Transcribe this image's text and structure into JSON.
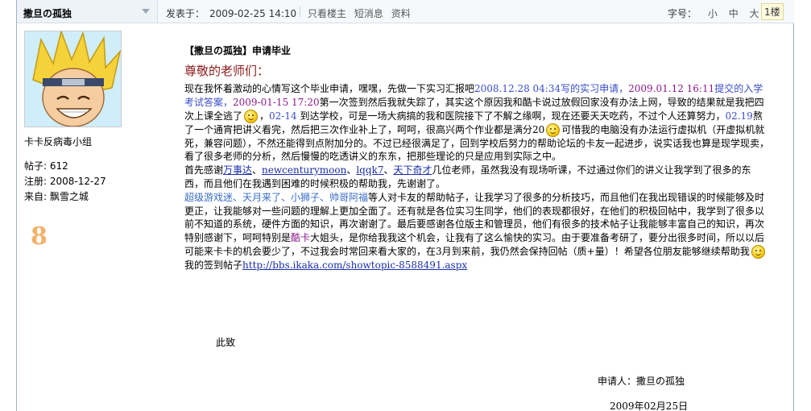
{
  "header": {
    "username": "撒旦の孤独",
    "posted_label": "发表于：",
    "posted_time": "2009-02-25 14:10",
    "links": [
      "只看楼主",
      "短消息",
      "资料"
    ],
    "font_size_label": "字号：",
    "font_sizes": [
      "小",
      "中",
      "大"
    ],
    "floor": "1楼"
  },
  "sidebar": {
    "group": "卡卡反病毒小组",
    "posts": "帖子: 612",
    "registered": "注册:  2008-12-27",
    "from": "来自: 飘雪之城",
    "rank_badge": "8"
  },
  "post": {
    "title": "【撒旦の孤独】申请毕业",
    "greeting": "尊敬的老师们：",
    "p1_a": "现在我怀着激动的心情写这个毕业申请，嘿嘿，先做一下实习汇报吧",
    "p1_b": "2008.12.28 04:34",
    "p1_c": "写的实习申请，",
    "p1_d": "2009.01.12 16:11",
    "p1_e": "提交的入学考试答案，",
    "p1_f": "2009-01-15 17:20",
    "p1_g": "第一次签到然后我就失踪了，其实这个原因我和酷卡说过放假回家没有办法上网，导致的结果就是我把四次上课全逃了",
    "p1_h": "，",
    "p1_i": "02-14",
    "p1_j": " 到达学校，可是一场大病搞的我和医院接下了不解之缘啊，现在还要天天吃药，不过个人还算努力，",
    "p1_k": "02.19",
    "p1_l": "熬了一个通宵把讲义看完，然后把三次作业补上了，呵呵，很高兴两个作业都是满分20",
    "p1_m": "可惜我的电脑没有办法运行虚拟机（开虚拟机就死，兼容问题），不然还能得到点附加分的。不过已经很满足了，回到学校后努力的帮助论坛的卡友一起进步，说实话我也算是现学现卖，看了很多老师的分析，然后慢慢的吃透讲义的东东，把那些理论的只是应用到实际之中。",
    "p2_a": "首先感谢",
    "teachers": [
      "万事达",
      "newcenturymoon",
      "lqqk7",
      "天下奇才"
    ],
    "teacher_sep": "、",
    "p2_b": "几位老师，虽然我没有现场听课，不过通过你们的讲义让我学到了很多的东西，而且他们在我遇到困难的时候积极的帮助我，先谢谢了。",
    "p3_a": "超级游戏迷、天月来了、小狮子、帅哥阿福",
    "p3_b": "等人对卡友的帮助帖子，让我学习了很多的分析技巧，而且他们在我出现错误的时候能够及时更正，让我能够对一些问题的理解上更加全面了。还有就是各位实习生同学，他们的表现都很好，在他们的积极回帖中，我学到了很多以前不知道的系统，硬件方面的知识，再次谢谢了。最后要感谢各位版主和管理员，他们有很多的技术帖子让我能够丰富自己的知识，再次特别感谢下，呵呵特别是",
    "p3_c": "酷卡",
    "p3_d": "大姐头，是你给我我这个机会，让我有了这么愉快的实习。由于要准备考研了，要分出很多时间，所以以后可能来卡卡的机会要少了，不过我会时常回来看大家的，在3月到来前，我仍然会保持回帖（质+量）！希望各位朋友能够继续帮助我",
    "p4_a": "我的签到帖子",
    "p4_link": "http://bbs.ikaka.com/showtopic-8588491.aspx",
    "closing": "此致",
    "applicant": "申请人：撒旦の孤独",
    "date": "2009年02月25日"
  }
}
